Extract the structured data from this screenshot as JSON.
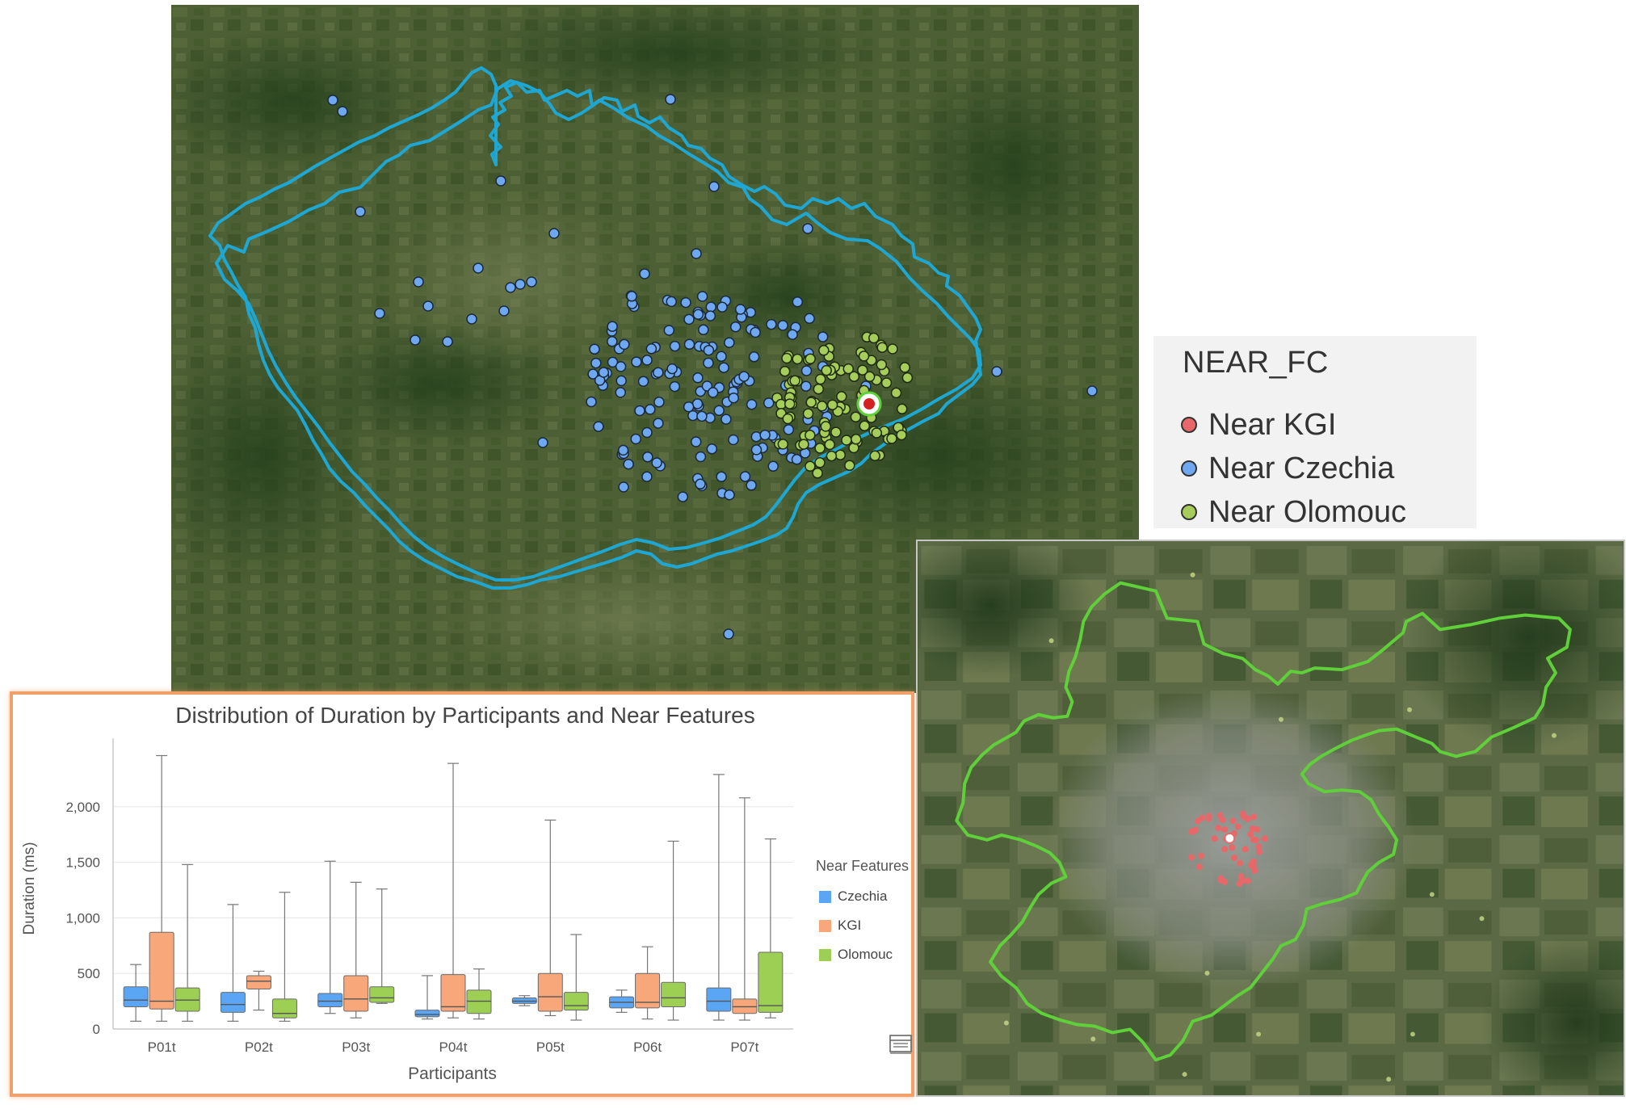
{
  "legend": {
    "title": "NEAR_FC",
    "items": [
      {
        "label": "Near KGI",
        "color": "#e8686a"
      },
      {
        "label": "Near Czechia",
        "color": "#6fa8f0"
      },
      {
        "label": "Near Olomouc",
        "color": "#a6cc5a"
      }
    ]
  },
  "map": {
    "boundary_color": "#1fa7d4",
    "inset_boundary_color": "#5fcf3a",
    "point_colors": {
      "czechia": "#6fa8f0",
      "olomouc": "#a6cc5a",
      "kgi": "#e8686a"
    }
  },
  "chart": {
    "title": "Distribution of Duration by Participants and Near Features",
    "legend_title": "Near Features",
    "footer_icon": "table-icon"
  },
  "chart_data": {
    "type": "box",
    "title": "Distribution of Duration by Participants and Near Features",
    "xlabel": "Participants",
    "ylabel": "Duration (ms)",
    "ylim": [
      0,
      2500
    ],
    "yticks": [
      0,
      500,
      1000,
      1500,
      2000
    ],
    "ytick_labels": [
      "0",
      "500",
      "1,000",
      "1,500",
      "2,000"
    ],
    "grid": true,
    "legend_position": "right",
    "categories": [
      "P01t",
      "P02t",
      "P03t",
      "P04t",
      "P05t",
      "P06t",
      "P07t"
    ],
    "series": [
      {
        "name": "Czechia",
        "color": "#5aa6f5",
        "boxes": [
          {
            "min": 70,
            "q1": 200,
            "median": 260,
            "q3": 380,
            "max": 580
          },
          {
            "min": 70,
            "q1": 150,
            "median": 220,
            "q3": 330,
            "max": 1120
          },
          {
            "min": 140,
            "q1": 200,
            "median": 250,
            "q3": 320,
            "max": 1510
          },
          {
            "min": 90,
            "q1": 110,
            "median": 130,
            "q3": 170,
            "max": 480
          },
          {
            "min": 210,
            "q1": 230,
            "median": 250,
            "q3": 280,
            "max": 300
          },
          {
            "min": 150,
            "q1": 190,
            "median": 240,
            "q3": 290,
            "max": 350
          },
          {
            "min": 80,
            "q1": 160,
            "median": 250,
            "q3": 370,
            "max": 2290
          }
        ]
      },
      {
        "name": "KGI",
        "color": "#f7a77a",
        "boxes": [
          {
            "min": 70,
            "q1": 180,
            "median": 250,
            "q3": 870,
            "max": 2460
          },
          {
            "min": 170,
            "q1": 360,
            "median": 430,
            "q3": 480,
            "max": 520
          },
          {
            "min": 100,
            "q1": 160,
            "median": 270,
            "q3": 480,
            "max": 1320
          },
          {
            "min": 100,
            "q1": 160,
            "median": 200,
            "q3": 490,
            "max": 2390
          },
          {
            "min": 120,
            "q1": 160,
            "median": 290,
            "q3": 500,
            "max": 1880
          },
          {
            "min": 90,
            "q1": 190,
            "median": 240,
            "q3": 500,
            "max": 740
          },
          {
            "min": 80,
            "q1": 140,
            "median": 200,
            "q3": 270,
            "max": 2080
          }
        ]
      },
      {
        "name": "Olomouc",
        "color": "#9dcf55",
        "boxes": [
          {
            "min": 70,
            "q1": 160,
            "median": 260,
            "q3": 370,
            "max": 1480
          },
          {
            "min": 70,
            "q1": 100,
            "median": 140,
            "q3": 270,
            "max": 1230
          },
          {
            "min": 230,
            "q1": 240,
            "median": 280,
            "q3": 380,
            "max": 1260
          },
          {
            "min": 90,
            "q1": 140,
            "median": 250,
            "q3": 350,
            "max": 540
          },
          {
            "min": 80,
            "q1": 170,
            "median": 210,
            "q3": 330,
            "max": 850
          },
          {
            "min": 80,
            "q1": 200,
            "median": 280,
            "q3": 420,
            "max": 1690
          },
          {
            "min": 100,
            "q1": 150,
            "median": 210,
            "q3": 690,
            "max": 1710
          }
        ]
      }
    ]
  }
}
